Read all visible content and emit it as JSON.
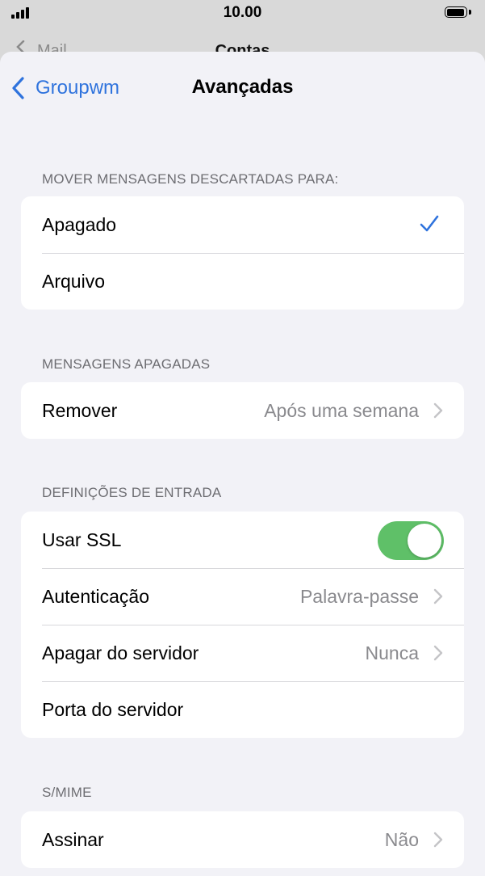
{
  "status_bar": {
    "time": "10.00",
    "icons": [
      "signal-icon",
      "battery-icon"
    ]
  },
  "background_page": {
    "back_label": "Mail",
    "title": "Contas"
  },
  "nav": {
    "back_label": "Groupwm",
    "title": "Avançadas"
  },
  "sections": {
    "move": {
      "header": "MOVER MENSAGENS DESCARTADAS PARA:",
      "options": [
        {
          "label": "Apagado",
          "selected": true
        },
        {
          "label": "Arquivo",
          "selected": false
        }
      ]
    },
    "deleted": {
      "header": "MENSAGENS APAGADAS",
      "remove_label": "Remover",
      "remove_value": "Após uma semana"
    },
    "incoming": {
      "header": "DEFINIÇÕES DE ENTRADA",
      "ssl_label": "Usar SSL",
      "ssl_on": true,
      "auth_label": "Autenticação",
      "auth_value": "Palavra-passe",
      "delete_label": "Apagar do servidor",
      "delete_value": "Nunca",
      "port_label": "Porta do servidor"
    },
    "smime": {
      "header": "S/MIME",
      "sign_label": "Assinar",
      "sign_value": "Não"
    }
  },
  "colors": {
    "accent": "#2f73dd",
    "toggle_on": "#5fc068",
    "background": "#f2f2f7"
  }
}
